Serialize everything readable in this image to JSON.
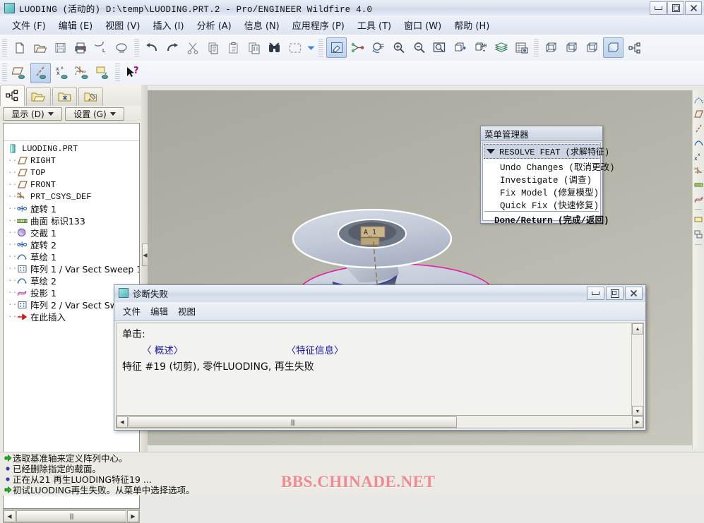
{
  "titlebar": {
    "title": "LUODING (活动的) D:\\temp\\LUODING.PRT.2 - Pro/ENGINEER Wildfire 4.0",
    "icon": "part-window-icon",
    "minimize": "minimize-button",
    "restore": "restore-button",
    "close": "close-button"
  },
  "menubar": {
    "items": [
      {
        "label": "文件 (F)"
      },
      {
        "label": "编辑 (E)"
      },
      {
        "label": "视图 (V)"
      },
      {
        "label": "插入 (I)"
      },
      {
        "label": "分析 (A)"
      },
      {
        "label": "信息 (N)"
      },
      {
        "label": "应用程序 (P)"
      },
      {
        "label": "工具 (T)"
      },
      {
        "label": "窗口 (W)"
      },
      {
        "label": "帮助 (H)"
      }
    ]
  },
  "leftpanel": {
    "tabs": [
      {
        "name": "model-tree-tab"
      },
      {
        "name": "folder-browser-tab"
      },
      {
        "name": "favorites-folder-tab"
      },
      {
        "name": "connections-tab"
      }
    ],
    "buttons": [
      {
        "label": "显示 (D)"
      },
      {
        "label": "设置 (G)"
      }
    ],
    "tree": [
      {
        "label": "LUODING.PRT",
        "icon": "part-icon",
        "indent": 0,
        "cjk": false
      },
      {
        "label": "RIGHT",
        "icon": "datum-plane-icon",
        "indent": 1,
        "cjk": false
      },
      {
        "label": "TOP",
        "icon": "datum-plane-icon",
        "indent": 1,
        "cjk": false
      },
      {
        "label": "FRONT",
        "icon": "datum-plane-icon",
        "indent": 1,
        "cjk": false
      },
      {
        "label": "PRT_CSYS_DEF",
        "icon": "coordinate-system-icon",
        "indent": 1,
        "cjk": false
      },
      {
        "label": "旋转 1",
        "icon": "revolve-icon",
        "indent": 1,
        "cjk": true
      },
      {
        "label": "曲面 标识133",
        "icon": "surface-icon",
        "indent": 1,
        "cjk": true
      },
      {
        "label": "交截 1",
        "icon": "intersect-icon",
        "indent": 1,
        "cjk": true
      },
      {
        "label": "旋转 2",
        "icon": "revolve-icon",
        "indent": 1,
        "cjk": true
      },
      {
        "label": "草绘 1",
        "icon": "sketch-icon",
        "indent": 1,
        "cjk": true
      },
      {
        "label": "阵列 1 / Var Sect Sweep 1",
        "icon": "pattern-icon",
        "indent": 1,
        "cjk": true
      },
      {
        "label": "草绘 2",
        "icon": "sketch-icon",
        "indent": 1,
        "cjk": true
      },
      {
        "label": "投影 1",
        "icon": "project-icon",
        "indent": 1,
        "cjk": true
      },
      {
        "label": "阵列 2 / Var Sect Sw",
        "icon": "pattern-icon",
        "indent": 1,
        "cjk": true
      },
      {
        "label": "在此插入",
        "icon": "insert-here-icon",
        "indent": 1,
        "cjk": true
      }
    ]
  },
  "menu_manager": {
    "title": "菜单管理器",
    "header": "RESOLVE FEAT (求解特征)",
    "items": [
      {
        "label": "Undo Changes (取消更改)",
        "bold": false
      },
      {
        "label": "Investigate (调查)",
        "bold": false
      },
      {
        "label": "Fix Model (修复模型)",
        "bold": false
      },
      {
        "label": "Quick Fix (快速修复)",
        "bold": false
      }
    ],
    "footer": "Done/Return (完成/返回)"
  },
  "diagnostics": {
    "title": "诊断失败",
    "menu": [
      "文件",
      "编辑",
      "视图"
    ],
    "prompt": "单击:",
    "link_overview": "〈 概述〉",
    "link_feature_info": "〈特征信息〉",
    "message": "特征 #19 (切剪), 零件LUODING,  再生失败",
    "minimize": "minimize-button",
    "restore": "restore-button",
    "close": "close-button"
  },
  "messages": [
    {
      "icon": "green-arrow",
      "text": "选取基准轴来定义阵列中心。"
    },
    {
      "icon": "blue-dot",
      "text": "已经删除指定的截面。"
    },
    {
      "icon": "blue-dot",
      "text": "正在从21  再生LUODING特征19 ..."
    },
    {
      "icon": "green-arrow",
      "text": "初试LUODING再生失败。从菜单中选择选项。"
    }
  ],
  "watermark": "BBS.CHINADE.NET",
  "colors": {
    "accent_blue": "#1a1aa8",
    "watermark_pink": "#ef8a92",
    "viewport_bg": "#b5b4a8",
    "model_magenta": "#e020a0",
    "selected_highlight": "#ccd4e2"
  }
}
